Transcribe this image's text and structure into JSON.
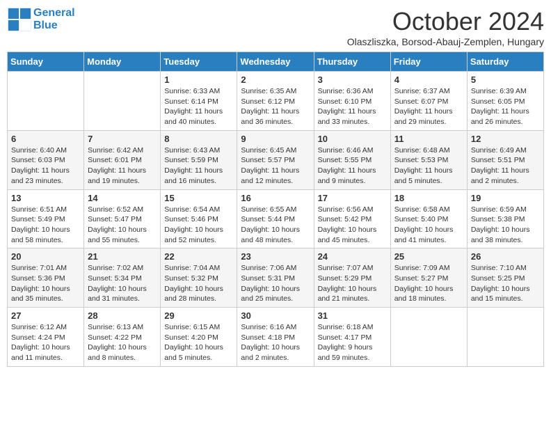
{
  "header": {
    "logo_line1": "General",
    "logo_line2": "Blue",
    "month_title": "October 2024",
    "subtitle": "Olaszliszka, Borsod-Abauj-Zemplen, Hungary"
  },
  "weekdays": [
    "Sunday",
    "Monday",
    "Tuesday",
    "Wednesday",
    "Thursday",
    "Friday",
    "Saturday"
  ],
  "weeks": [
    [
      {
        "day": "",
        "info": ""
      },
      {
        "day": "",
        "info": ""
      },
      {
        "day": "1",
        "info": "Sunrise: 6:33 AM\nSunset: 6:14 PM\nDaylight: 11 hours and 40 minutes."
      },
      {
        "day": "2",
        "info": "Sunrise: 6:35 AM\nSunset: 6:12 PM\nDaylight: 11 hours and 36 minutes."
      },
      {
        "day": "3",
        "info": "Sunrise: 6:36 AM\nSunset: 6:10 PM\nDaylight: 11 hours and 33 minutes."
      },
      {
        "day": "4",
        "info": "Sunrise: 6:37 AM\nSunset: 6:07 PM\nDaylight: 11 hours and 29 minutes."
      },
      {
        "day": "5",
        "info": "Sunrise: 6:39 AM\nSunset: 6:05 PM\nDaylight: 11 hours and 26 minutes."
      }
    ],
    [
      {
        "day": "6",
        "info": "Sunrise: 6:40 AM\nSunset: 6:03 PM\nDaylight: 11 hours and 23 minutes."
      },
      {
        "day": "7",
        "info": "Sunrise: 6:42 AM\nSunset: 6:01 PM\nDaylight: 11 hours and 19 minutes."
      },
      {
        "day": "8",
        "info": "Sunrise: 6:43 AM\nSunset: 5:59 PM\nDaylight: 11 hours and 16 minutes."
      },
      {
        "day": "9",
        "info": "Sunrise: 6:45 AM\nSunset: 5:57 PM\nDaylight: 11 hours and 12 minutes."
      },
      {
        "day": "10",
        "info": "Sunrise: 6:46 AM\nSunset: 5:55 PM\nDaylight: 11 hours and 9 minutes."
      },
      {
        "day": "11",
        "info": "Sunrise: 6:48 AM\nSunset: 5:53 PM\nDaylight: 11 hours and 5 minutes."
      },
      {
        "day": "12",
        "info": "Sunrise: 6:49 AM\nSunset: 5:51 PM\nDaylight: 11 hours and 2 minutes."
      }
    ],
    [
      {
        "day": "13",
        "info": "Sunrise: 6:51 AM\nSunset: 5:49 PM\nDaylight: 10 hours and 58 minutes."
      },
      {
        "day": "14",
        "info": "Sunrise: 6:52 AM\nSunset: 5:47 PM\nDaylight: 10 hours and 55 minutes."
      },
      {
        "day": "15",
        "info": "Sunrise: 6:54 AM\nSunset: 5:46 PM\nDaylight: 10 hours and 52 minutes."
      },
      {
        "day": "16",
        "info": "Sunrise: 6:55 AM\nSunset: 5:44 PM\nDaylight: 10 hours and 48 minutes."
      },
      {
        "day": "17",
        "info": "Sunrise: 6:56 AM\nSunset: 5:42 PM\nDaylight: 10 hours and 45 minutes."
      },
      {
        "day": "18",
        "info": "Sunrise: 6:58 AM\nSunset: 5:40 PM\nDaylight: 10 hours and 41 minutes."
      },
      {
        "day": "19",
        "info": "Sunrise: 6:59 AM\nSunset: 5:38 PM\nDaylight: 10 hours and 38 minutes."
      }
    ],
    [
      {
        "day": "20",
        "info": "Sunrise: 7:01 AM\nSunset: 5:36 PM\nDaylight: 10 hours and 35 minutes."
      },
      {
        "day": "21",
        "info": "Sunrise: 7:02 AM\nSunset: 5:34 PM\nDaylight: 10 hours and 31 minutes."
      },
      {
        "day": "22",
        "info": "Sunrise: 7:04 AM\nSunset: 5:32 PM\nDaylight: 10 hours and 28 minutes."
      },
      {
        "day": "23",
        "info": "Sunrise: 7:06 AM\nSunset: 5:31 PM\nDaylight: 10 hours and 25 minutes."
      },
      {
        "day": "24",
        "info": "Sunrise: 7:07 AM\nSunset: 5:29 PM\nDaylight: 10 hours and 21 minutes."
      },
      {
        "day": "25",
        "info": "Sunrise: 7:09 AM\nSunset: 5:27 PM\nDaylight: 10 hours and 18 minutes."
      },
      {
        "day": "26",
        "info": "Sunrise: 7:10 AM\nSunset: 5:25 PM\nDaylight: 10 hours and 15 minutes."
      }
    ],
    [
      {
        "day": "27",
        "info": "Sunrise: 6:12 AM\nSunset: 4:24 PM\nDaylight: 10 hours and 11 minutes."
      },
      {
        "day": "28",
        "info": "Sunrise: 6:13 AM\nSunset: 4:22 PM\nDaylight: 10 hours and 8 minutes."
      },
      {
        "day": "29",
        "info": "Sunrise: 6:15 AM\nSunset: 4:20 PM\nDaylight: 10 hours and 5 minutes."
      },
      {
        "day": "30",
        "info": "Sunrise: 6:16 AM\nSunset: 4:18 PM\nDaylight: 10 hours and 2 minutes."
      },
      {
        "day": "31",
        "info": "Sunrise: 6:18 AM\nSunset: 4:17 PM\nDaylight: 9 hours and 59 minutes."
      },
      {
        "day": "",
        "info": ""
      },
      {
        "day": "",
        "info": ""
      }
    ]
  ]
}
